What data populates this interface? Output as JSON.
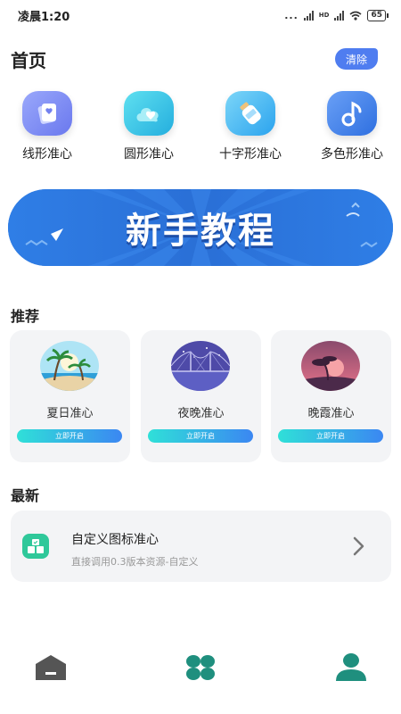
{
  "status_bar": {
    "time": "凌晨1:20",
    "dots": "...",
    "network_label": "HD",
    "battery": "65"
  },
  "header": {
    "title": "首页",
    "clear_label": "清除"
  },
  "categories": [
    {
      "label": "线形准心",
      "icon": "cards-icon",
      "color": "#7b8ef5"
    },
    {
      "label": "圆形准心",
      "icon": "cloud-heart-icon",
      "color": "#38c7e8"
    },
    {
      "label": "十字形准心",
      "icon": "bottle-icon",
      "color": "#4ab6ef"
    },
    {
      "label": "多色形准心",
      "icon": "music-note-icon",
      "color": "#3e7fe8"
    }
  ],
  "banner": {
    "text": "新手教程"
  },
  "recommend": {
    "title": "推荐",
    "items": [
      {
        "name": "夏日准心",
        "button": "立即开启",
        "icon": "beach-palm-icon"
      },
      {
        "name": "夜晚准心",
        "button": "立即开启",
        "icon": "night-bridge-icon"
      },
      {
        "name": "晚霞准心",
        "button": "立即开启",
        "icon": "sunset-tree-icon"
      }
    ]
  },
  "latest": {
    "title": "最新",
    "item_title": "自定义图标准心",
    "item_subtitle": "直接调用0.3版本资源-自定义"
  },
  "bottom_nav": [
    {
      "icon": "home-icon",
      "active": false
    },
    {
      "icon": "grid-clover-icon",
      "active": false
    },
    {
      "icon": "user-icon",
      "active": true
    }
  ],
  "colors": {
    "accent": "#4f7df0",
    "teal": "#2a9d8f",
    "dark_icon": "#555555",
    "card_bg": "#f3f4f6"
  }
}
